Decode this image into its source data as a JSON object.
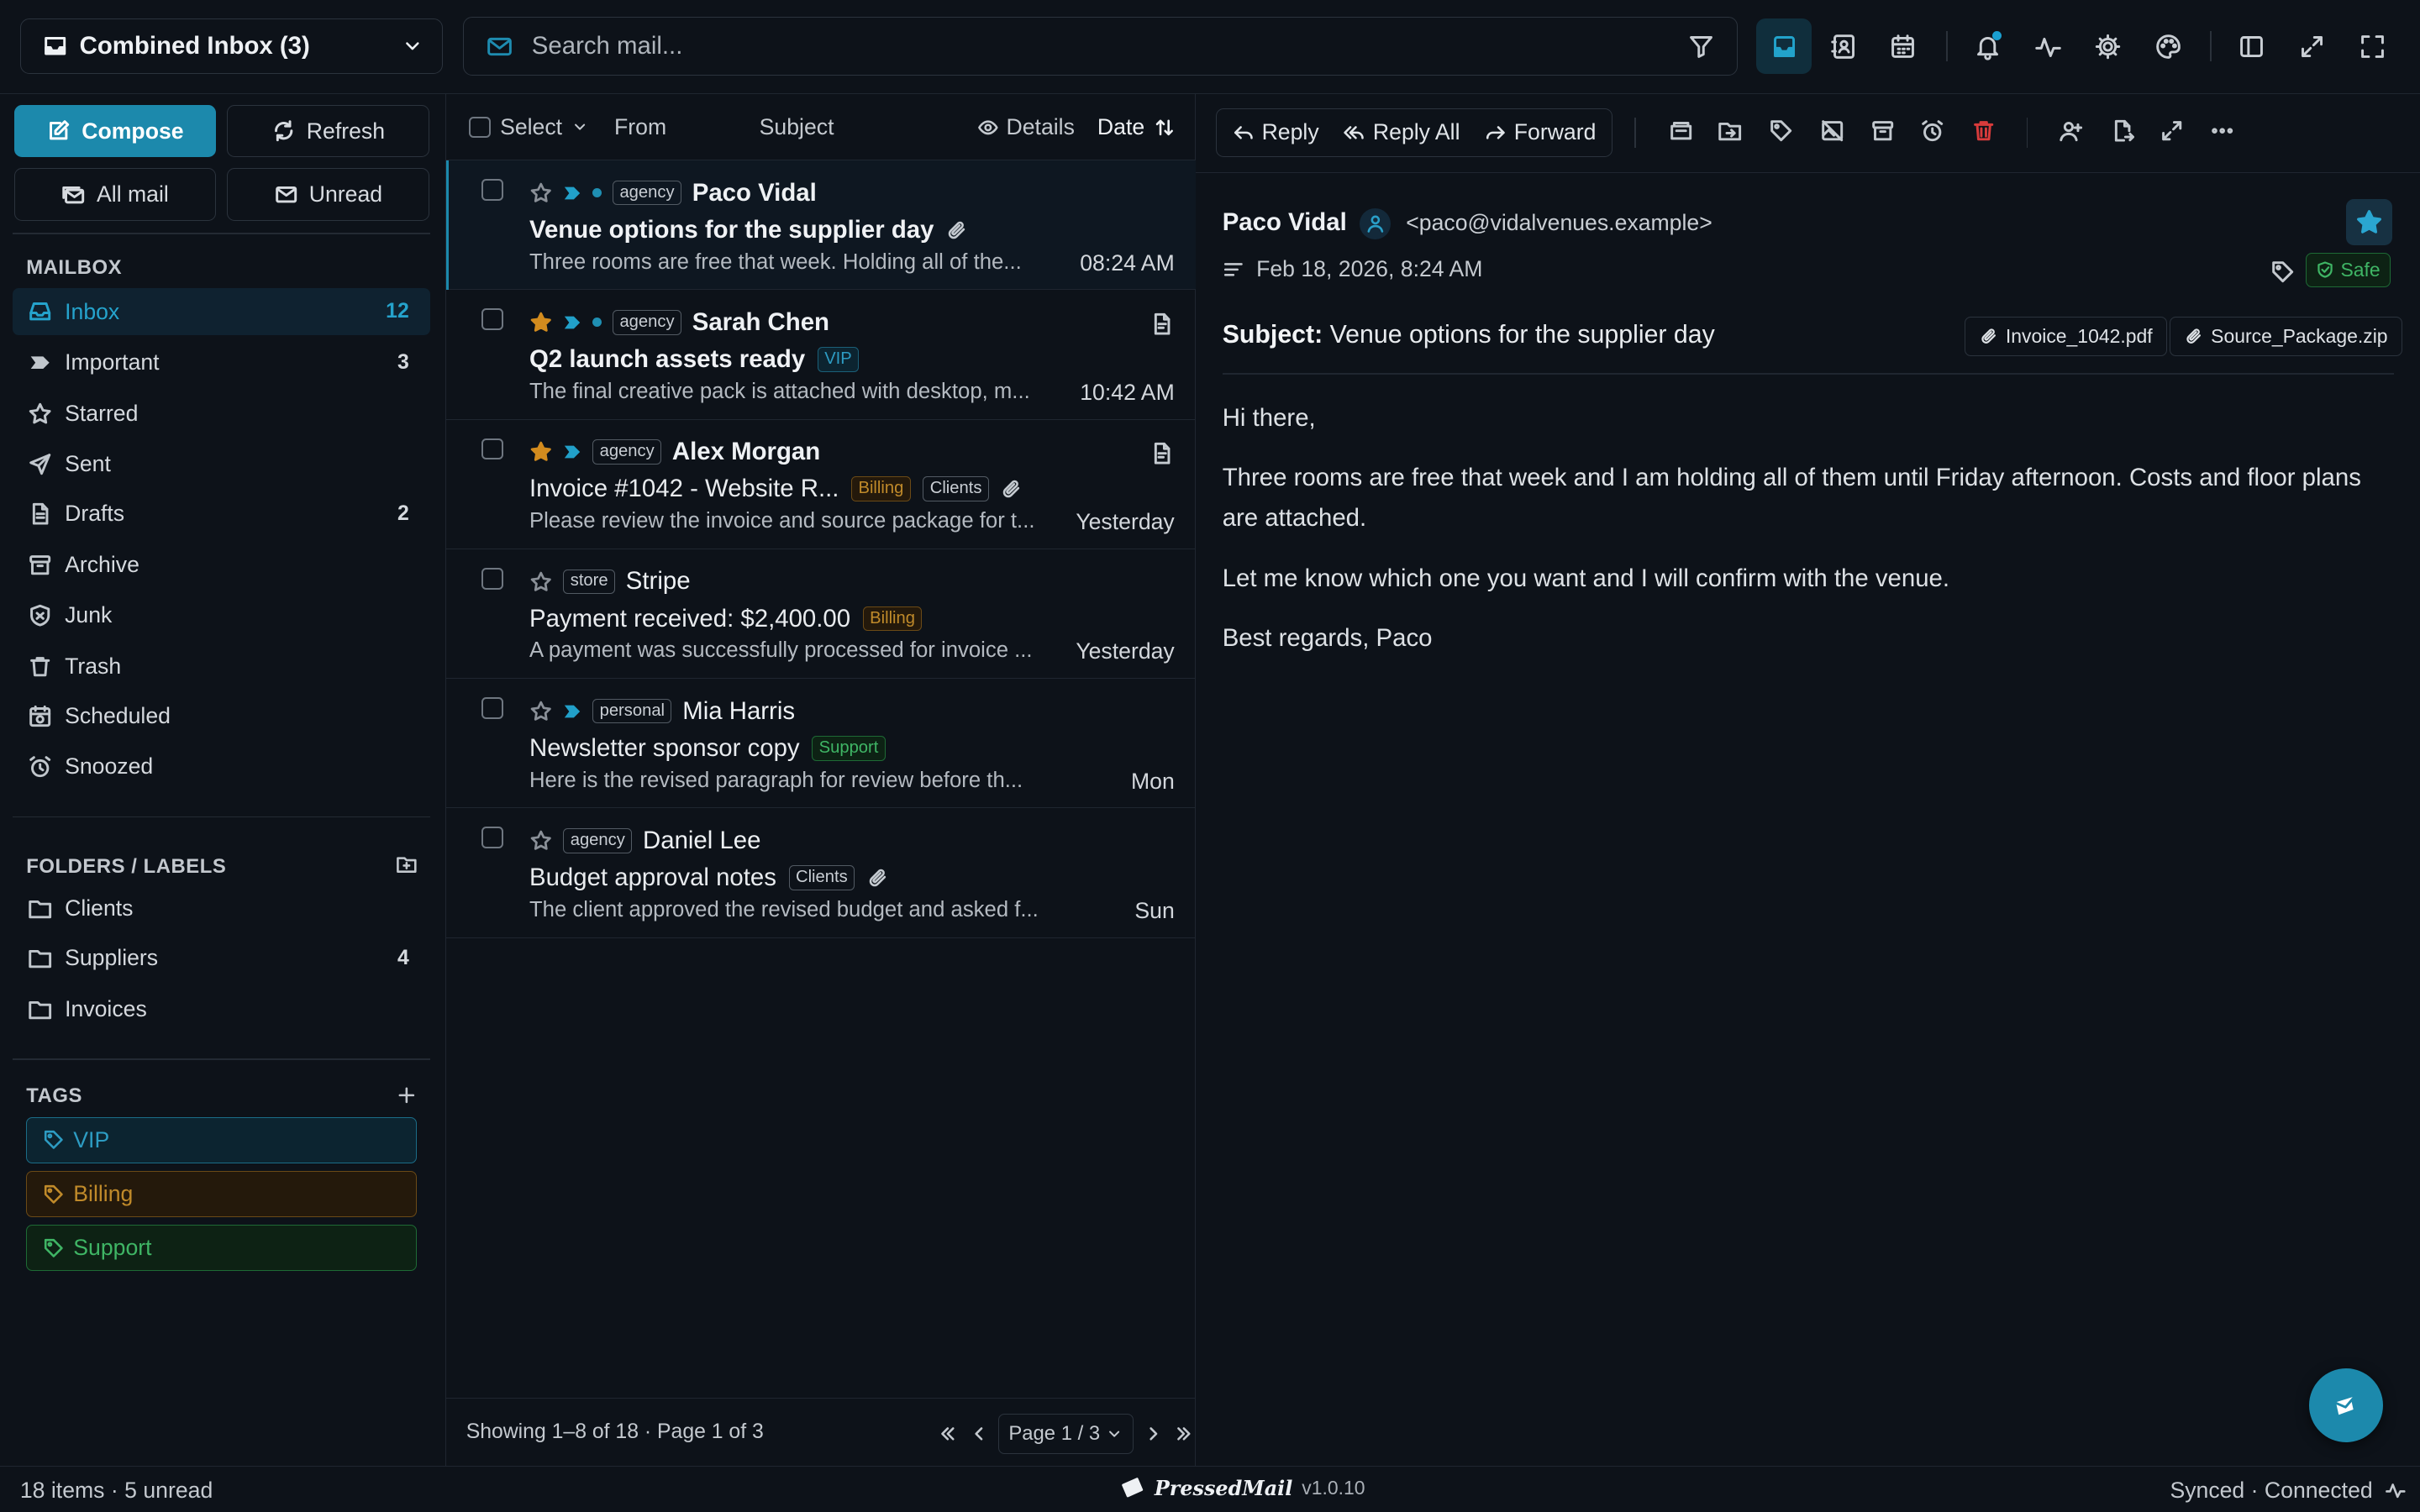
{
  "topbar": {
    "account_selector": "Combined Inbox (3)",
    "search_placeholder": "Search mail...",
    "icons": [
      "mail-view-icon",
      "contacts-icon",
      "calendar-icon",
      "bell-icon",
      "activity-icon",
      "gear-icon",
      "palette-icon",
      "sidebar-toggle-icon",
      "expand-icon",
      "fullscreen-icon"
    ],
    "accent_color": "#1c89ac"
  },
  "sidebar": {
    "compose_label": "Compose",
    "refresh_label": "Refresh",
    "all_mail_label": "All mail",
    "unread_label": "Unread",
    "mailbox_title": "MAILBOX",
    "mailbox": [
      {
        "label": "Inbox",
        "count": "12"
      },
      {
        "label": "Important",
        "count": "3"
      },
      {
        "label": "Starred",
        "count": ""
      },
      {
        "label": "Sent",
        "count": ""
      },
      {
        "label": "Drafts",
        "count": "2"
      },
      {
        "label": "Archive",
        "count": ""
      },
      {
        "label": "Junk",
        "count": ""
      },
      {
        "label": "Trash",
        "count": ""
      },
      {
        "label": "Scheduled",
        "count": ""
      },
      {
        "label": "Snoozed",
        "count": ""
      }
    ],
    "folders_title": "FOLDERS / LABELS",
    "folders": [
      {
        "label": "Clients",
        "count": ""
      },
      {
        "label": "Suppliers",
        "count": "4"
      },
      {
        "label": "Invoices",
        "count": ""
      }
    ],
    "tags_title": "TAGS",
    "tags": [
      {
        "label": "VIP",
        "color": "#2d9cc3"
      },
      {
        "label": "Billing",
        "color": "#c08a2a"
      },
      {
        "label": "Support",
        "color": "#3fb565"
      }
    ]
  },
  "list": {
    "select_label": "Select",
    "col_from": "From",
    "col_subject": "Subject",
    "details_label": "Details",
    "date_label": "Date",
    "messages": [
      {
        "source": "agency",
        "sender": "Paco Vidal",
        "subject": "Venue options for the supplier day",
        "preview": "Three rooms are free that week. Holding all of the...",
        "time": "08:24 AM",
        "starred": false,
        "important": true,
        "unread": true
      },
      {
        "source": "agency",
        "sender": "Sarah Chen",
        "subject": "Q2 launch assets ready",
        "label": "VIP",
        "preview": "The final creative pack is attached with desktop, m...",
        "time": "10:42 AM",
        "starred": true,
        "important": true,
        "unread": true
      },
      {
        "source": "agency",
        "sender": "Alex Morgan",
        "subject": "Invoice #1042 - Website R...",
        "labels": [
          "Billing",
          "Clients"
        ],
        "preview": "Please review the invoice and source package for t...",
        "time": "Yesterday",
        "starred": true,
        "important": true,
        "unread": false
      },
      {
        "source": "store",
        "sender": "Stripe",
        "subject": "Payment received: $2,400.00",
        "label": "Billing",
        "preview": "A payment was successfully processed for invoice ...",
        "time": "Yesterday",
        "starred": false,
        "important": false,
        "unread": false
      },
      {
        "source": "personal",
        "sender": "Mia Harris",
        "subject": "Newsletter sponsor copy",
        "label": "Support",
        "preview": "Here is the revised paragraph for review before th...",
        "time": "Mon",
        "starred": false,
        "important": true,
        "unread": false
      },
      {
        "source": "agency",
        "sender": "Daniel Lee",
        "subject": "Budget approval notes",
        "label": "Clients",
        "preview": "The client approved the revised budget and asked f...",
        "time": "Sun",
        "starred": false,
        "important": false,
        "unread": false
      }
    ],
    "footer_text": "Showing 1–8 of 18 · Page 1 of 3",
    "page_select": "Page 1 / 3"
  },
  "reader": {
    "reply_label": "Reply",
    "reply_all_label": "Reply All",
    "forward_label": "Forward",
    "sender_name": "Paco Vidal",
    "sender_email": "<paco@vidalvenues.example>",
    "date": "Feb 18, 2026, 8:24 AM",
    "safe_label": "Safe",
    "subject_prefix": "Subject:",
    "subject": "Venue options for the supplier day",
    "attachments": [
      "Invoice_1042.pdf",
      "Source_Package.zip"
    ],
    "body": [
      "Hi there,",
      "Three rooms are free that week and I am holding all of them until Friday afternoon. Costs and floor plans are attached.",
      "Let me know which one you want and I will confirm with the venue.",
      "Best regards, Paco"
    ]
  },
  "statusbar": {
    "counts": "18 items · 5 unread",
    "brand": "PressedMail",
    "version": "v1.0.10",
    "sync": "Synced · Connected"
  }
}
